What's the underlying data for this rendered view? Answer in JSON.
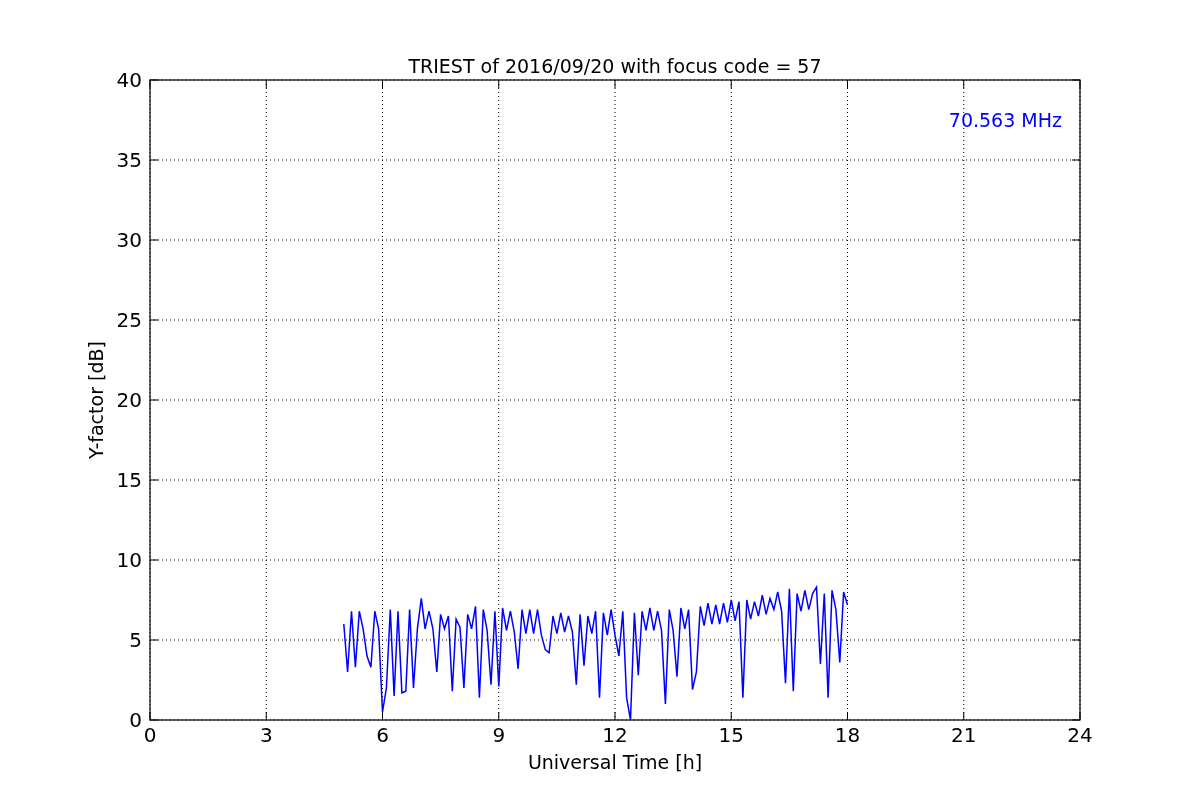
{
  "chart": {
    "chart_data": {
      "type": "line",
      "title": "TRIEST of 2016/09/20 with focus code = 57",
      "xlabel": "Universal Time [h]",
      "ylabel": "Y-factor [dB]",
      "xlim": [
        0,
        24
      ],
      "ylim": [
        0,
        40
      ],
      "xticks": [
        0,
        3,
        6,
        9,
        12,
        15,
        18,
        21,
        24
      ],
      "yticks": [
        0,
        5,
        10,
        15,
        20,
        25,
        30,
        35,
        40
      ],
      "x": [
        5.0,
        5.1,
        5.2,
        5.3,
        5.4,
        5.5,
        5.6,
        5.7,
        5.8,
        5.9,
        6.0,
        6.1,
        6.2,
        6.3,
        6.4,
        6.5,
        6.6,
        6.7,
        6.8,
        6.9,
        7.0,
        7.1,
        7.2,
        7.3,
        7.4,
        7.5,
        7.6,
        7.7,
        7.8,
        7.9,
        8.0,
        8.1,
        8.2,
        8.3,
        8.4,
        8.5,
        8.6,
        8.7,
        8.8,
        8.9,
        9.0,
        9.1,
        9.2,
        9.3,
        9.4,
        9.5,
        9.6,
        9.7,
        9.8,
        9.9,
        10.0,
        10.1,
        10.2,
        10.3,
        10.4,
        10.5,
        10.6,
        10.7,
        10.8,
        10.9,
        11.0,
        11.1,
        11.2,
        11.3,
        11.4,
        11.5,
        11.6,
        11.7,
        11.8,
        11.9,
        12.0,
        12.1,
        12.2,
        12.3,
        12.4,
        12.5,
        12.6,
        12.7,
        12.8,
        12.9,
        13.0,
        13.1,
        13.2,
        13.3,
        13.4,
        13.5,
        13.6,
        13.7,
        13.8,
        13.9,
        14.0,
        14.1,
        14.2,
        14.3,
        14.4,
        14.5,
        14.6,
        14.7,
        14.8,
        14.9,
        15.0,
        15.1,
        15.2,
        15.3,
        15.4,
        15.5,
        15.6,
        15.7,
        15.8,
        15.9,
        16.0,
        16.1,
        16.2,
        16.3,
        16.4,
        16.5,
        16.6,
        16.7,
        16.8,
        16.9,
        17.0,
        17.1,
        17.2,
        17.3,
        17.4,
        17.5,
        17.6,
        17.7,
        17.8,
        17.9,
        18.0
      ],
      "series": [
        {
          "color": "#0000ff",
          "values": [
            6.0,
            3.0,
            6.8,
            3.3,
            6.8,
            5.7,
            4.0,
            3.3,
            6.8,
            5.7,
            0.5,
            2.0,
            6.9,
            1.5,
            6.8,
            1.7,
            1.8,
            6.9,
            2.0,
            5.7,
            7.6,
            5.7,
            6.8,
            5.7,
            3.0,
            6.6,
            5.7,
            6.5,
            1.8,
            6.3,
            5.8,
            2.0,
            6.6,
            5.7,
            7.1,
            1.4,
            6.9,
            5.6,
            2.2,
            6.8,
            2.1,
            7.0,
            5.6,
            6.8,
            5.5,
            3.2,
            6.9,
            5.4,
            6.9,
            5.4,
            6.9,
            5.3,
            4.4,
            4.2,
            6.5,
            5.4,
            6.7,
            5.5,
            6.5,
            5.5,
            2.2,
            6.6,
            3.4,
            6.5,
            5.4,
            6.8,
            1.4,
            6.7,
            5.3,
            6.9,
            5.3,
            4.0,
            6.8,
            1.4,
            0,
            6.7,
            2.8,
            6.8,
            5.6,
            7.0,
            5.6,
            6.8,
            5.6,
            1.0,
            6.9,
            5.6,
            2.7,
            7.0,
            5.7,
            6.9,
            1.9,
            3.0,
            7.1,
            5.9,
            7.3,
            6.0,
            7.2,
            6.0,
            7.3,
            6.1,
            7.5,
            6.2,
            7.4,
            1.4,
            7.5,
            6.3,
            7.4,
            6.5,
            7.8,
            6.6,
            7.6,
            6.9,
            8.0,
            6.8,
            2.3,
            8.2,
            1.8,
            7.9,
            6.8,
            8.1,
            6.9,
            7.9,
            8.3,
            3.5,
            7.9,
            1.4,
            8.1,
            6.9,
            3.6,
            8.0,
            7.2
          ]
        }
      ],
      "grid": true,
      "annotations": [
        "70.563 MHz"
      ]
    }
  }
}
